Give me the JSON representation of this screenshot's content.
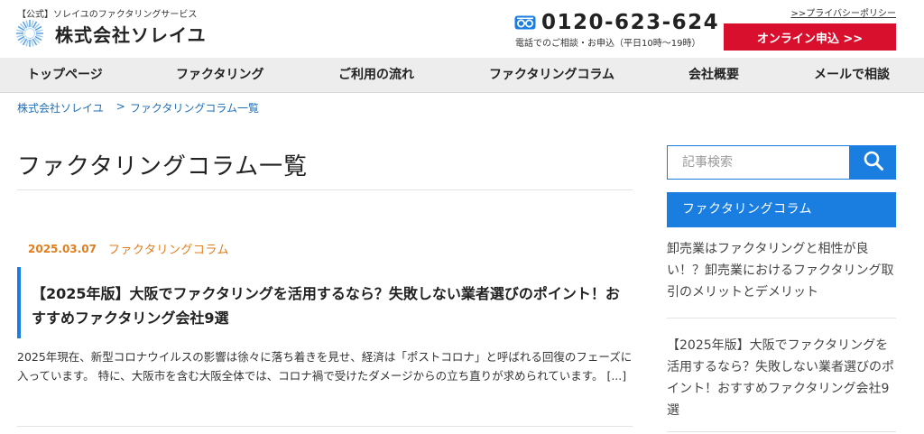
{
  "header": {
    "tagline": "【公式】ソレイユのファクタリングサービス",
    "company_name": "株式会社ソレイユ",
    "phone_number": "0120-623-624",
    "phone_note": "電話でのご相談・お申込（平日10時〜19時）",
    "privacy_link": ">>プライバシーポリシー",
    "apply_button": "オンライン申込 >>",
    "apply_color": "#d8102e"
  },
  "nav": {
    "items": [
      {
        "label": "トップページ"
      },
      {
        "label": "ファクタリング"
      },
      {
        "label": "ご利用の流れ"
      },
      {
        "label": "ファクタリングコラム"
      },
      {
        "label": "会社概要"
      },
      {
        "label": "メールで相談"
      }
    ]
  },
  "breadcrumb": {
    "home": "株式会社ソレイユ",
    "separator": ">",
    "current": "ファクタリングコラム一覧"
  },
  "main": {
    "page_title": "ファクタリングコラム一覧",
    "post": {
      "date": "2025.03.07",
      "category": "ファクタリングコラム",
      "title": "【2025年版】大阪でファクタリングを活用するなら？失敗しない業者選びのポイント！おすすめファクタリング会社9選",
      "excerpt": "2025年現在、新型コロナウイルスの影響は徐々に落ち着きを見せ、経済は「ポストコロナ」と呼ばれる回復のフェーズに入っています。 特に、大阪市を含む大阪全体では、コロナ禍で受けたダメージからの立ち直りが求められています。 [...]"
    }
  },
  "sidebar": {
    "search_placeholder": "記事検索",
    "heading": "ファクタリングコラム",
    "articles": [
      {
        "title": "卸売業はファクタリングと相性が良い！？卸売業におけるファクタリング取引のメリットとデメリット"
      },
      {
        "title": "【2025年版】大阪でファクタリングを活用するなら？失敗しない業者選びのポイント！おすすめファクタリング会社9選"
      }
    ]
  },
  "colors": {
    "accent_blue": "#1a7ee0",
    "accent_orange": "#e07e1e",
    "link_blue": "#1f6fb5"
  },
  "icons": {
    "logo": "sun-logo-icon",
    "phone": "freedial-icon",
    "search": "search-icon"
  }
}
